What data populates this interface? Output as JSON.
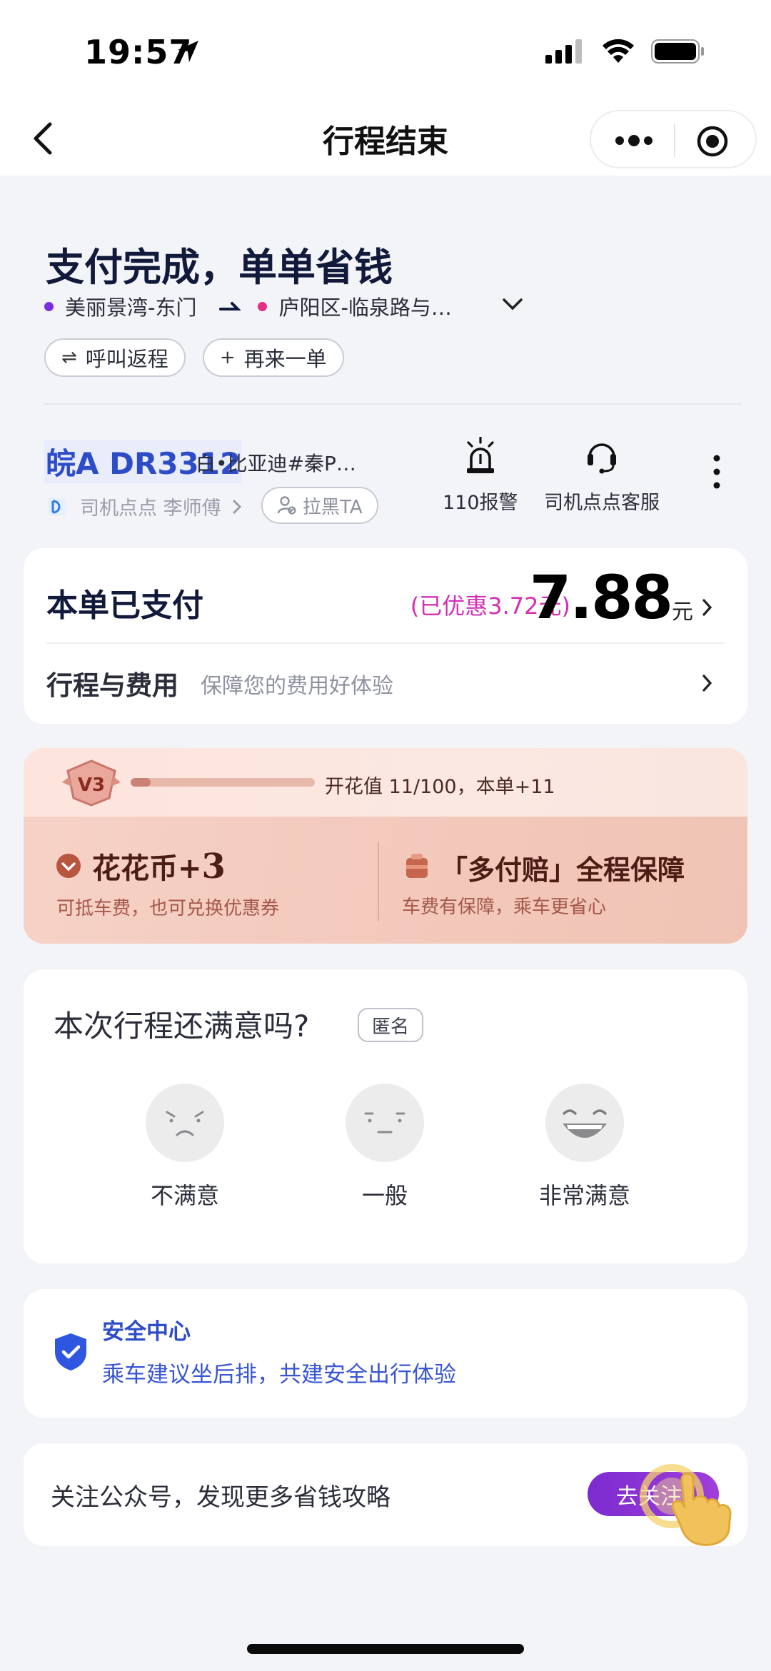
{
  "status_bar": {
    "time": "19:57"
  },
  "nav": {
    "title": "行程结束"
  },
  "header": {
    "headline": "支付完成，单单省钱",
    "route_from": "美丽景湾-东门",
    "route_to": "庐阳区-临泉路与…",
    "call_return": "呼叫返程",
    "reorder": "再来一单"
  },
  "driver": {
    "plate": "皖A DR3312",
    "car": "白•比亚迪#秦P…",
    "driver_line": "司机点点 李师傅",
    "block": "拉黑TA",
    "police": "110报警",
    "service": "司机点点客服"
  },
  "payment": {
    "label": "本单已支付",
    "discount": "(已优惠3.72元)",
    "amount": "7.88",
    "unit": "元",
    "fee_title": "行程与费用",
    "fee_sub": "保障您的费用好体验"
  },
  "bloom": {
    "level": "V3",
    "progress": 0.11,
    "progress_text": "开花值 11/100，本单+11",
    "coin_label": "花花币+",
    "coin_value": "3",
    "coin_sub": "可抵车费，也可兑换优惠券",
    "guard_title": "「多付赔」全程保障",
    "guard_sub": "车费有保障，乘车更省心"
  },
  "rating": {
    "title": "本次行程还满意吗?",
    "anon": "匿名",
    "options": [
      "不满意",
      "一般",
      "非常满意"
    ]
  },
  "safety": {
    "title": "安全中心",
    "sub": "乘车建议坐后排，共建安全出行体验"
  },
  "follow": {
    "text": "关注公众号，发现更多省钱攻略",
    "button": "去关注"
  },
  "colors": {
    "accent_blue": "#2d4cc8",
    "accent_pink": "#d42fb6",
    "follow_purple": "#8a33d4"
  }
}
